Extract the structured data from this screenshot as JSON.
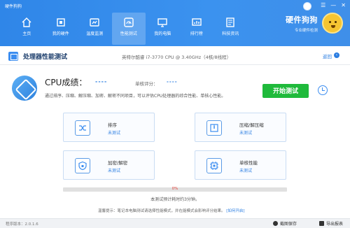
{
  "app_title": "硬件狗狗",
  "window_controls": {
    "menu": "☰",
    "minimize": "—",
    "close": "✕"
  },
  "nav": [
    {
      "label": "主页",
      "icon": "home-icon"
    },
    {
      "label": "我的硬件",
      "icon": "chip-icon"
    },
    {
      "label": "温度监测",
      "icon": "thermometer-icon"
    },
    {
      "label": "性能测试",
      "icon": "speedometer-icon"
    },
    {
      "label": "我的电脑",
      "icon": "monitor-icon"
    },
    {
      "label": "排行榜",
      "icon": "ranking-icon"
    },
    {
      "label": "科技资讯",
      "icon": "news-icon"
    }
  ],
  "brand": {
    "title": "硬件狗狗",
    "subtitle": "专业硬件检测"
  },
  "page": {
    "title": "处理器性能测试",
    "cpu_name": "英特尔酷睿 i7-3770 CPU @ 3.40GHz（4核/8线程）",
    "back": "返回"
  },
  "score": {
    "label": "CPU成绩：",
    "value": "----",
    "single_label": "单核评分：",
    "single_value": "----",
    "description": "通过排序、压缩、解压缩、加密、解密不同项目，可以评估CPU处理器的综合性能、单核心性能。",
    "start_button": "开始测试"
  },
  "tests": [
    {
      "title": "排序",
      "status": "未测试"
    },
    {
      "title": "压缩/解压缩",
      "status": "未测试"
    },
    {
      "title": "加密/解密",
      "status": "未测试"
    },
    {
      "title": "单核性能",
      "status": "未测试"
    }
  ],
  "progress": {
    "percent": 0,
    "label": "0%"
  },
  "eta": "本测试预计耗时约3分钟。",
  "tip": {
    "text": "温馨提示：笔记本电脑测试请选择性能模式，并在能模式会影响评分结果。",
    "link": "[如何开启]"
  },
  "footer": {
    "version": "程序版本：2.0.1.6",
    "screenshot": "截图保存",
    "export": "导出报表"
  }
}
